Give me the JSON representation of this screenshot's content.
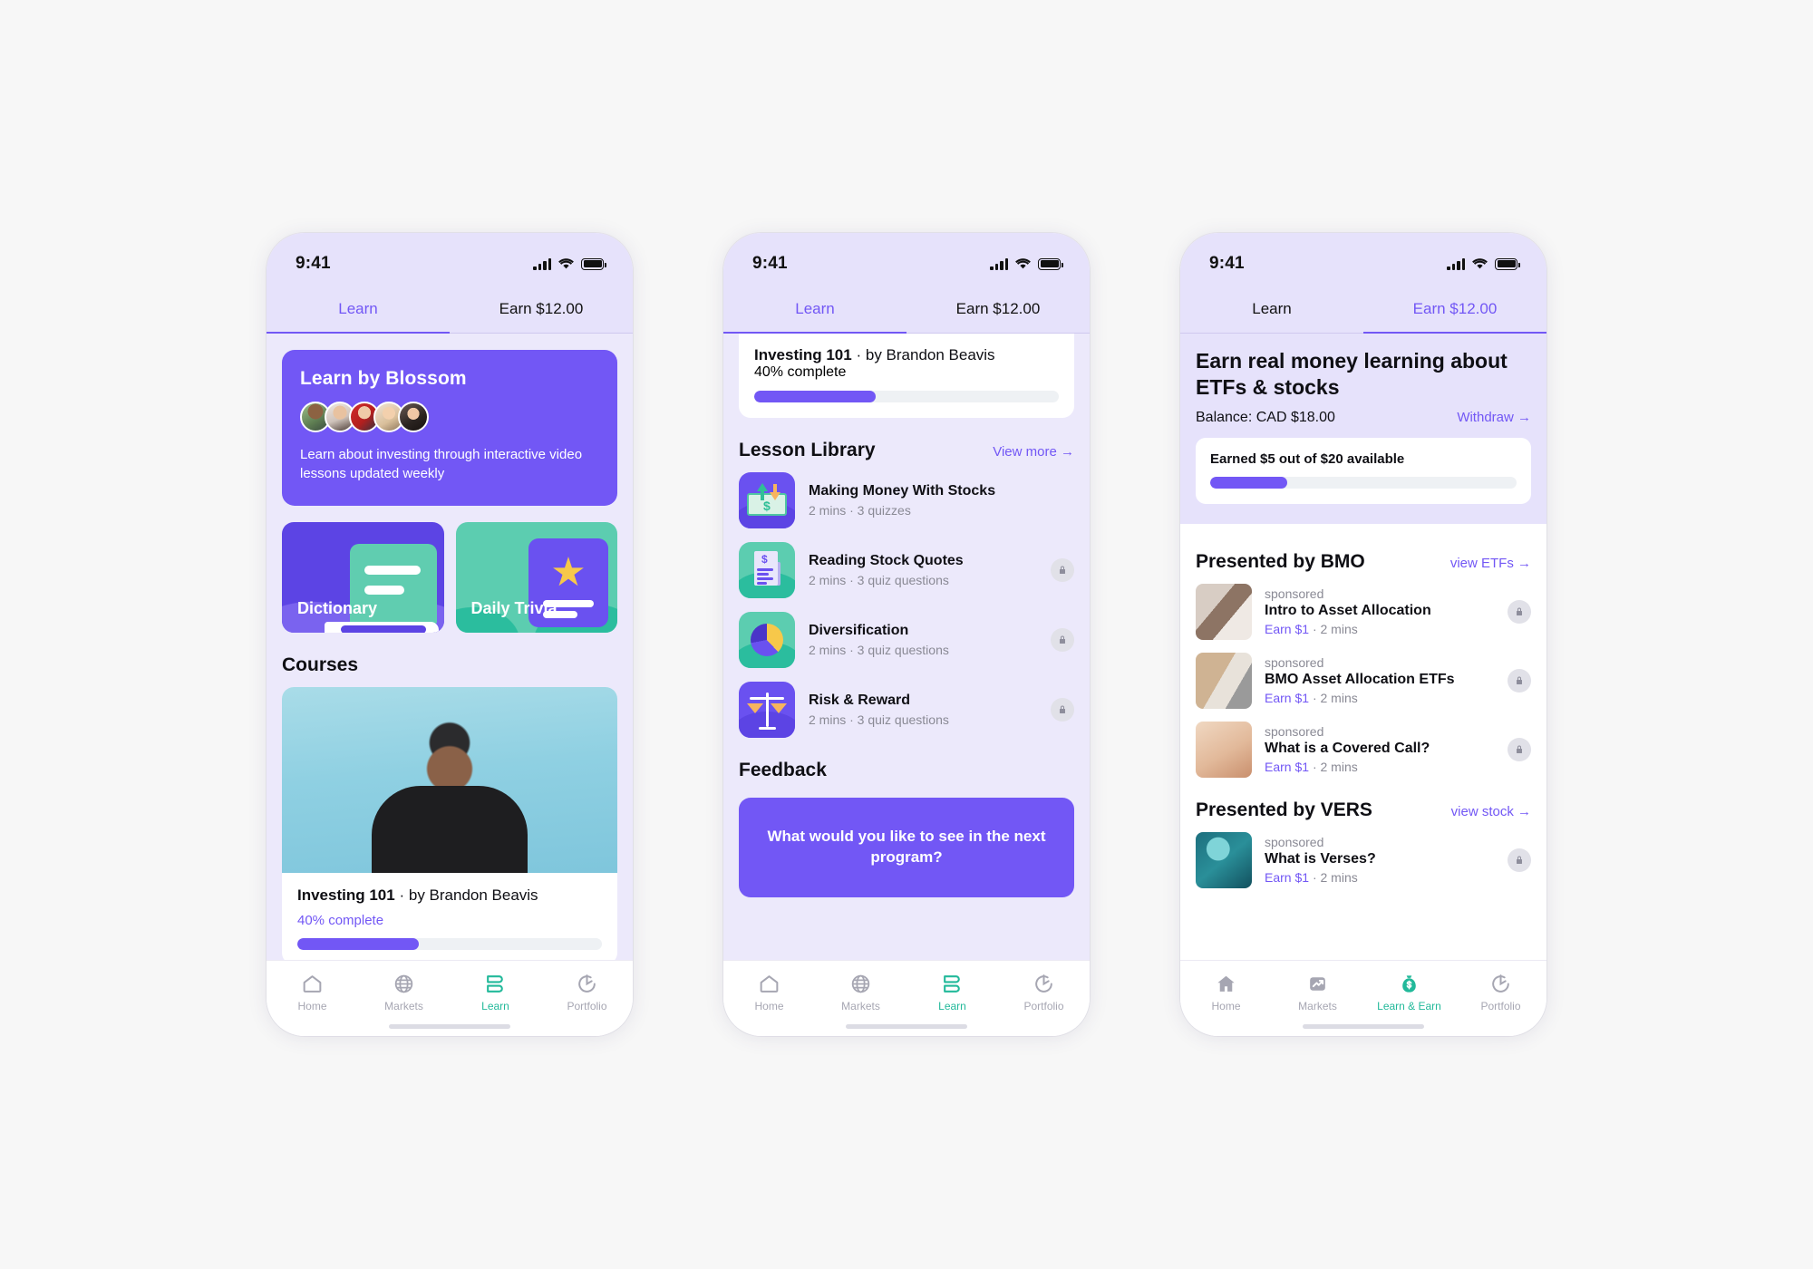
{
  "status": {
    "time": "9:41"
  },
  "tabs": {
    "learn": "Learn",
    "earn": "Earn $12.00"
  },
  "screen1": {
    "hero": {
      "title": "Learn by Blossom",
      "description": "Learn about investing through interactive video lessons updated weekly"
    },
    "tiles": [
      {
        "label": "Dictionary"
      },
      {
        "label": "Daily Trivia"
      }
    ],
    "courses_heading": "Courses",
    "course": {
      "title": "Investing 101",
      "separator": "·",
      "author": "by Brandon Beavis",
      "progress_label": "40% complete",
      "progress_pct": 40
    },
    "nav": [
      {
        "label": "Home",
        "icon": "home-icon",
        "active": false
      },
      {
        "label": "Markets",
        "icon": "globe-icon",
        "active": false
      },
      {
        "label": "Learn",
        "icon": "book-icon",
        "active": true
      },
      {
        "label": "Portfolio",
        "icon": "portfolio-icon",
        "active": false
      }
    ]
  },
  "screen2": {
    "course": {
      "title": "Investing 101",
      "separator": "·",
      "author": "by Brandon Beavis",
      "progress_label": "40% complete",
      "progress_pct": 40
    },
    "library_heading": "Lesson Library",
    "view_more": "View more →",
    "lessons": [
      {
        "title": "Making Money With Stocks",
        "meta": "2 mins · 3 quizzes",
        "locked": false,
        "art": "a1"
      },
      {
        "title": "Reading Stock Quotes",
        "meta": "2 mins · 3 quiz questions",
        "locked": true,
        "art": "a2"
      },
      {
        "title": "Diversification",
        "meta": "2 mins · 3 quiz questions",
        "locked": true,
        "art": "a3"
      },
      {
        "title": "Risk & Reward",
        "meta": "2 mins · 3 quiz questions",
        "locked": true,
        "art": "a4"
      }
    ],
    "feedback_heading": "Feedback",
    "feedback_prompt": "What would you like to see in the next program?",
    "nav": [
      {
        "label": "Home",
        "icon": "home-icon",
        "active": false
      },
      {
        "label": "Markets",
        "icon": "globe-icon",
        "active": false
      },
      {
        "label": "Learn",
        "icon": "book-icon",
        "active": true
      },
      {
        "label": "Portfolio",
        "icon": "portfolio-icon",
        "active": false
      }
    ]
  },
  "screen3": {
    "headline": "Earn real money learning about ETFs & stocks",
    "balance": "Balance: CAD $18.00",
    "withdraw": "Withdraw →",
    "earned_label": "Earned $5 out of $20 available",
    "earned_pct": 25,
    "sections": [
      {
        "heading": "Presented by BMO",
        "link": "view ETFs →",
        "items": [
          {
            "sponsored": "sponsored",
            "title": "Intro to Asset Allocation",
            "earn": "Earn $1",
            "sep": "·",
            "time": "2 mins",
            "locked": true,
            "pic": "pic1"
          },
          {
            "sponsored": "sponsored",
            "title": "BMO Asset Allocation ETFs",
            "earn": "Earn $1",
            "sep": "·",
            "time": "2 mins",
            "locked": true,
            "pic": "pic2"
          },
          {
            "sponsored": "sponsored",
            "title": "What is a Covered Call?",
            "earn": "Earn $1",
            "sep": "·",
            "time": "2 mins",
            "locked": true,
            "pic": "pic3"
          }
        ]
      },
      {
        "heading": "Presented by VERS",
        "link": "view stock →",
        "items": [
          {
            "sponsored": "sponsored",
            "title": "What is Verses?",
            "earn": "Earn $1",
            "sep": "·",
            "time": "2 mins",
            "locked": true,
            "pic": "pic4"
          }
        ]
      }
    ],
    "nav": [
      {
        "label": "Home",
        "icon": "home-icon",
        "active": false
      },
      {
        "label": "Markets",
        "icon": "chart-icon",
        "active": false
      },
      {
        "label": "Learn & Earn",
        "icon": "money-bag-icon",
        "active": true
      },
      {
        "label": "Portfolio",
        "icon": "portfolio-icon",
        "active": false
      }
    ]
  },
  "colors": {
    "purple": "#7257f5",
    "deep_purple": "#5c44e4",
    "teal": "#2bbd9e",
    "lavender_bg": "#ece9fb",
    "status_bg": "#e6e2fb"
  }
}
